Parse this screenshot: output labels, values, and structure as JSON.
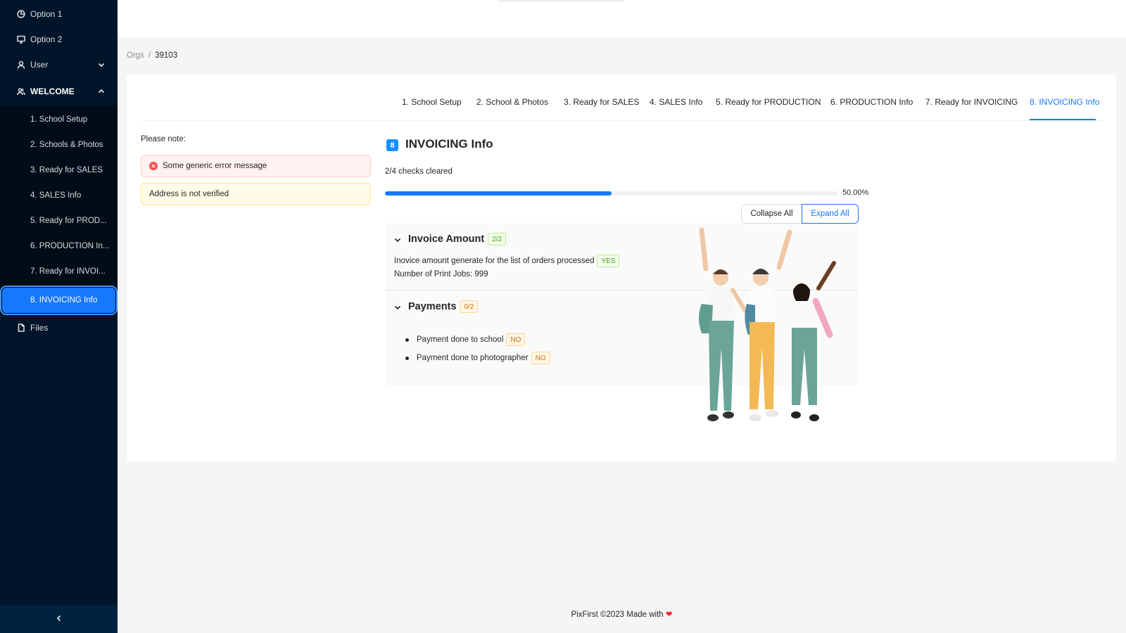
{
  "sidebar": {
    "items": [
      {
        "label": "Option 1",
        "icon": "pie-chart-icon"
      },
      {
        "label": "Option 2",
        "icon": "desktop-icon"
      },
      {
        "label": "User",
        "icon": "user-icon"
      },
      {
        "label": "WELCOME",
        "icon": "team-icon"
      }
    ],
    "submenu": [
      {
        "label": "1. School Setup"
      },
      {
        "label": "2. Schools & Photos"
      },
      {
        "label": "3. Ready for SALES"
      },
      {
        "label": "4. SALES Info"
      },
      {
        "label": "5. Ready for PROD..."
      },
      {
        "label": "6. PRODUCTION In..."
      },
      {
        "label": "7. Ready for INVOI..."
      },
      {
        "label": "8. INVOICING Info"
      }
    ],
    "files": {
      "label": "Files",
      "icon": "file-icon"
    },
    "active_index": 7,
    "accent_color": "#1677ff"
  },
  "breadcrumb": {
    "root": "Orgs",
    "separator": "/",
    "current": "39103"
  },
  "tabs": [
    {
      "label": "1. School Setup"
    },
    {
      "label": "2. School & Photos"
    },
    {
      "label": "3. Ready for SALES"
    },
    {
      "label": "4. SALES Info"
    },
    {
      "label": "5. Ready for PRODUCTION"
    },
    {
      "label": "6. PRODUCTION Info"
    },
    {
      "label": "7. Ready for INVOICING"
    },
    {
      "label": "8. INVOICING Info"
    }
  ],
  "active_tab": 7,
  "notes": {
    "label": "Please note:",
    "error": "Some generic error message",
    "warning": "Address is not verified"
  },
  "section": {
    "number": "8",
    "title": "INVOICING Info",
    "checks": "2/4 checks cleared",
    "progress": 0.5,
    "progress_text": "50.00%"
  },
  "buttons": {
    "collapse_all": "Collapse All",
    "expand_all": "Expand All"
  },
  "invoice_amount": {
    "title": "Invoice Amount",
    "badge": "2/2",
    "line1": "Inovice amount generate for the list of orders processed",
    "line1_tag": "YES",
    "line2": "Number of Print Jobs: 999"
  },
  "payments": {
    "title": "Payments",
    "badge": "0/2",
    "items": [
      {
        "label": "Payment done to school",
        "tag": "NO"
      },
      {
        "label": "Payment done to photographer",
        "tag": "NO"
      }
    ]
  },
  "footer": {
    "text": "PixFirst ©2023 Made with",
    "heart": "❤"
  }
}
